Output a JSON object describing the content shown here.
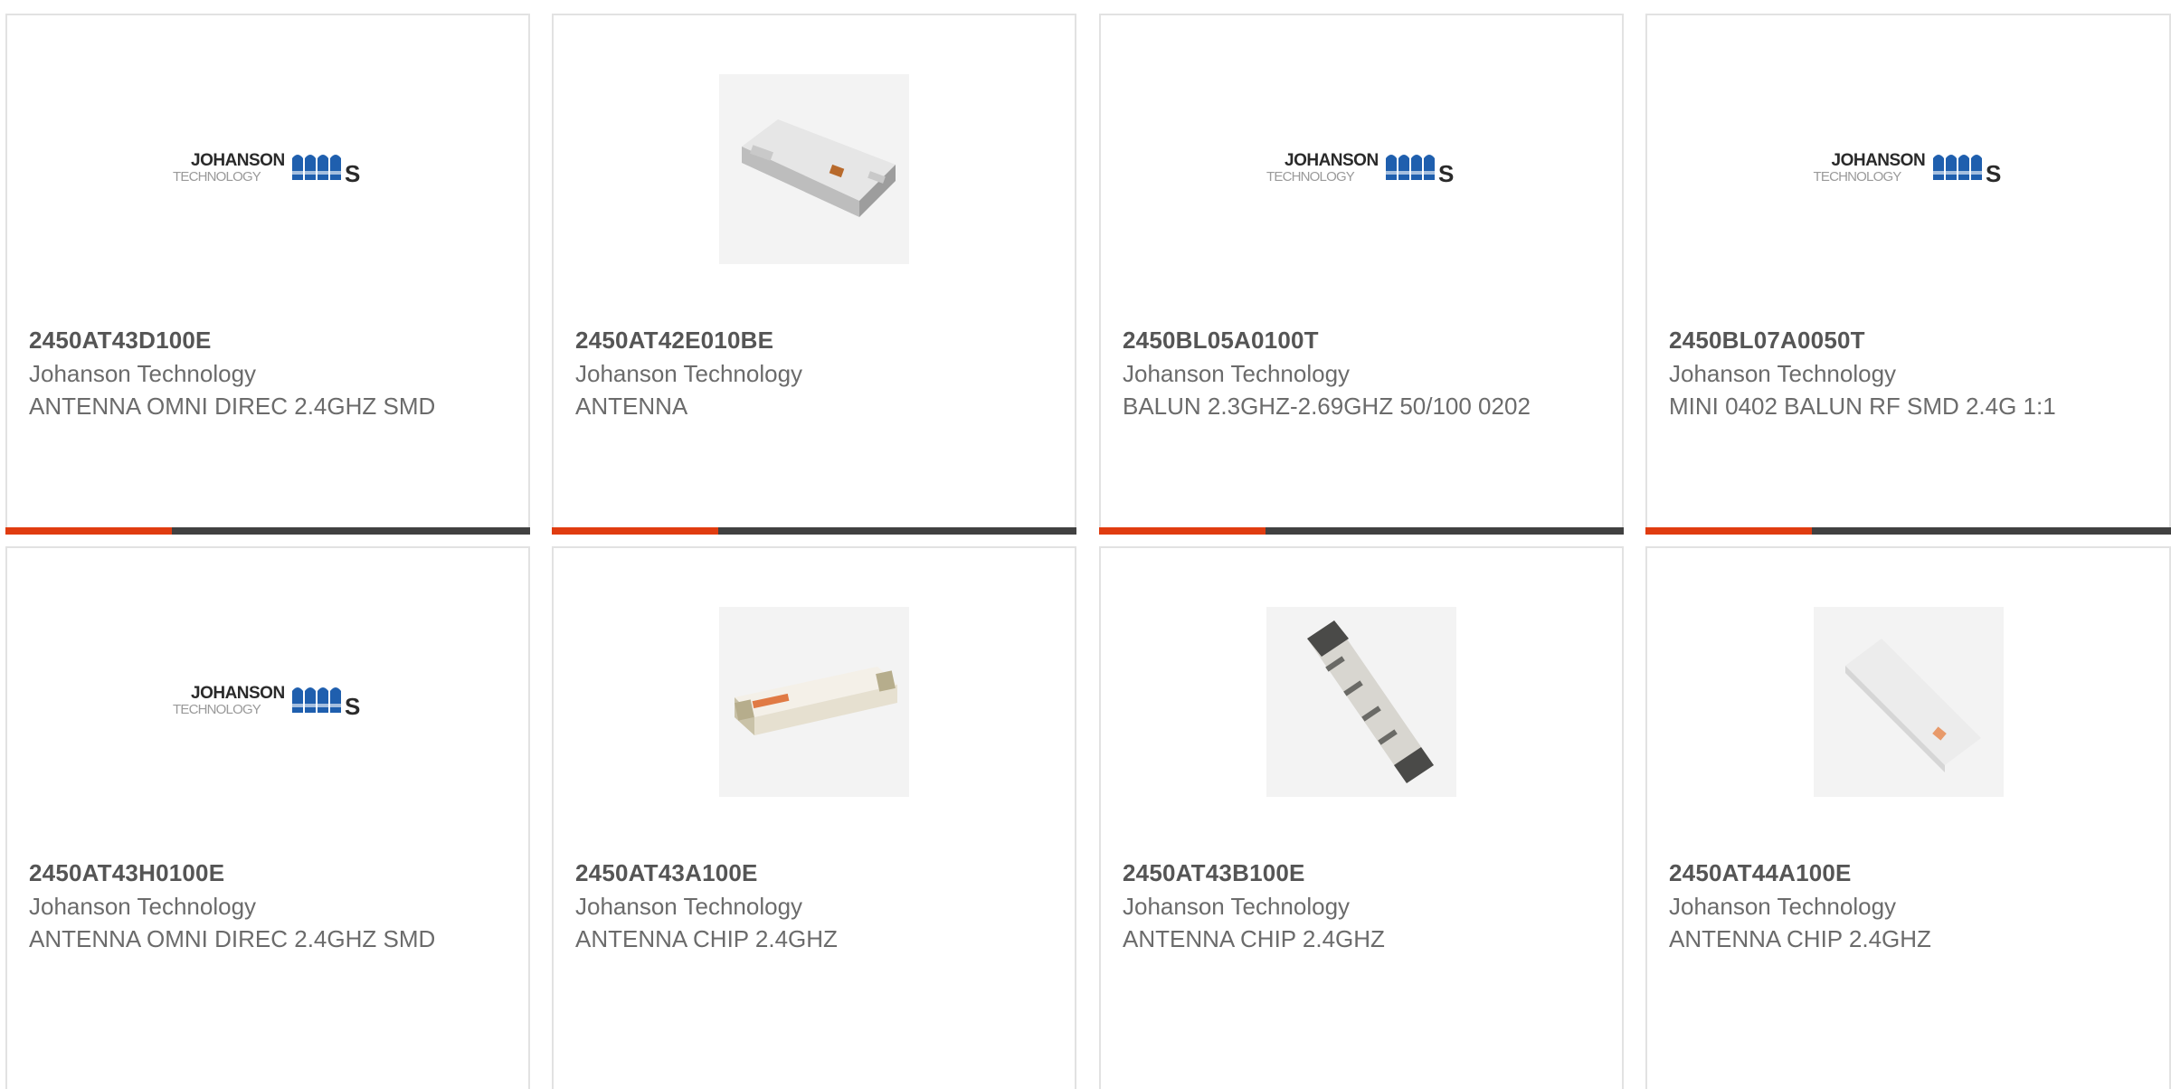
{
  "products": [
    {
      "part": "2450AT43D100E",
      "manufacturer": "Johanson Technology",
      "description": "ANTENNA OMNI DIREC 2.4GHZ SMD",
      "image": "johanson-logo",
      "logo_line1": "JOHANSON",
      "logo_line2": "TECHNOLOGY"
    },
    {
      "part": "2450AT42E010BE",
      "manufacturer": "Johanson Technology",
      "description": "ANTENNA",
      "image": "chip-flat-photo"
    },
    {
      "part": "2450BL05A0100T",
      "manufacturer": "Johanson Technology",
      "description": "BALUN 2.3GHZ-2.69GHZ 50/100 0202",
      "image": "johanson-logo",
      "logo_line1": "JOHANSON",
      "logo_line2": "TECHNOLOGY"
    },
    {
      "part": "2450BL07A0050T",
      "manufacturer": "Johanson Technology",
      "description": "MINI 0402 BALUN RF SMD 2.4G 1:1",
      "image": "johanson-logo",
      "logo_line1": "JOHANSON",
      "logo_line2": "TECHNOLOGY"
    },
    {
      "part": "2450AT43H0100E",
      "manufacturer": "Johanson Technology",
      "description": "ANTENNA OMNI DIREC 2.4GHZ SMD",
      "image": "johanson-logo",
      "logo_line1": "JOHANSON",
      "logo_line2": "TECHNOLOGY"
    },
    {
      "part": "2450AT43A100E",
      "manufacturer": "Johanson Technology",
      "description": "ANTENNA CHIP 2.4GHZ",
      "image": "chip-white-photo"
    },
    {
      "part": "2450AT43B100E",
      "manufacturer": "Johanson Technology",
      "description": "ANTENNA CHIP 2.4GHZ",
      "image": "chip-dark-photo"
    },
    {
      "part": "2450AT44A100E",
      "manufacturer": "Johanson Technology",
      "description": "ANTENNA CHIP 2.4GHZ",
      "image": "chip-clear-photo"
    }
  ],
  "colors": {
    "accent": "#e03c10",
    "bar": "#414141",
    "border": "#e2e2e2",
    "text_bold": "#555555",
    "text": "#6b6b6b",
    "logo_blue": "#1f5fae"
  }
}
